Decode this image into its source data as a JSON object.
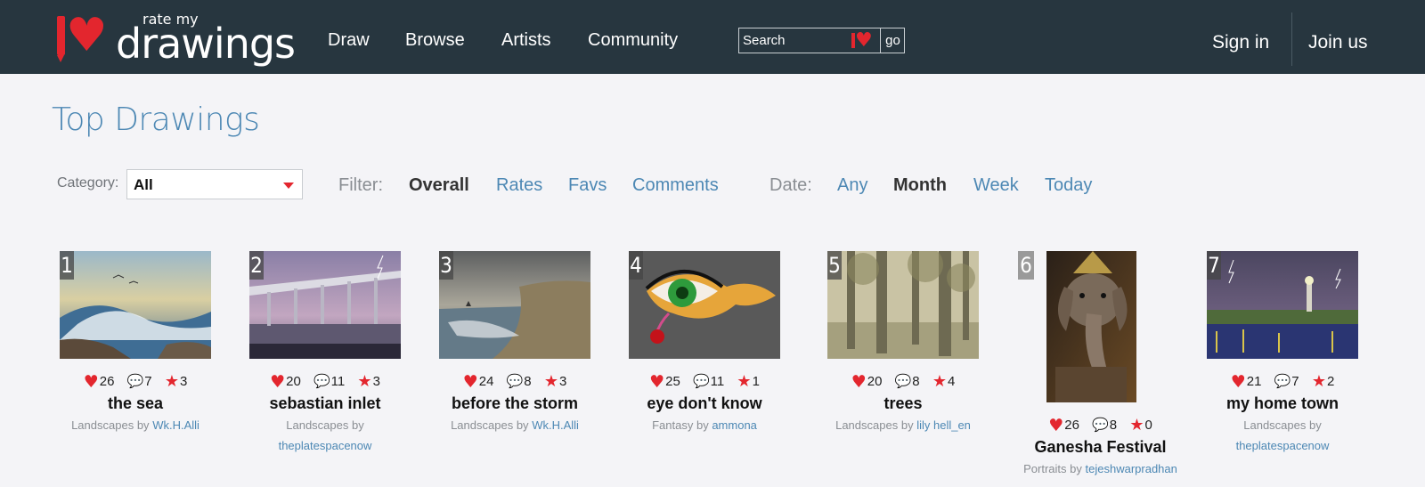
{
  "header": {
    "logo_small": "rate my",
    "logo_big": "drawings",
    "nav": [
      "Draw",
      "Browse",
      "Artists",
      "Community"
    ],
    "search_placeholder": "Search",
    "search_go": "go",
    "sign_in": "Sign in",
    "join_us": "Join us"
  },
  "page": {
    "title": "Top Drawings",
    "category_label": "Category:",
    "category_value": "All",
    "filter_label": "Filter:",
    "filter_options": [
      "Overall",
      "Rates",
      "Favs",
      "Comments"
    ],
    "filter_active": "Overall",
    "date_label": "Date:",
    "date_options": [
      "Any",
      "Month",
      "Week",
      "Today"
    ],
    "date_active": "Month",
    "by_word": "by"
  },
  "colors": {
    "header_bg": "#27363f",
    "accent_red": "#e3262e",
    "link_blue": "#4d88b4"
  },
  "drawings": [
    {
      "rank": "1",
      "title": "the sea",
      "category": "Landscapes",
      "author": "Wk.H.Alli",
      "hearts": "26",
      "comments": "7",
      "stars": "3"
    },
    {
      "rank": "2",
      "title": "sebastian inlet",
      "category": "Landscapes",
      "author": "theplatespacenow",
      "hearts": "20",
      "comments": "11",
      "stars": "3"
    },
    {
      "rank": "3",
      "title": "before the storm",
      "category": "Landscapes",
      "author": "Wk.H.Alli",
      "hearts": "24",
      "comments": "8",
      "stars": "3"
    },
    {
      "rank": "4",
      "title": "eye don't know",
      "category": "Fantasy",
      "author": "ammona",
      "hearts": "25",
      "comments": "11",
      "stars": "1"
    },
    {
      "rank": "5",
      "title": "trees",
      "category": "Landscapes",
      "author": "lily hell_en",
      "hearts": "20",
      "comments": "8",
      "stars": "4"
    },
    {
      "rank": "6",
      "title": "Ganesha Festival",
      "category": "Portraits",
      "author": "tejeshwarpradhan",
      "hearts": "26",
      "comments": "8",
      "stars": "0"
    },
    {
      "rank": "7",
      "title": "my home town",
      "category": "Landscapes",
      "author": "theplatespacenow",
      "hearts": "21",
      "comments": "7",
      "stars": "2"
    }
  ]
}
